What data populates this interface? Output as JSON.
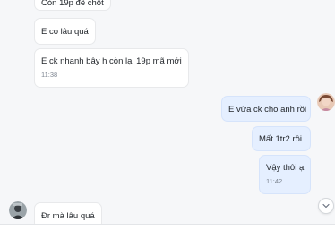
{
  "messages": [
    {
      "text": "Còn 19p để chốt",
      "direction": "incoming"
    },
    {
      "text": "E co lâu quá",
      "direction": "incoming"
    },
    {
      "text": "E ck nhanh bây h còn lại 19p mã mới",
      "time": "11:38",
      "direction": "incoming"
    },
    {
      "text": "E vừa ck cho anh rồi",
      "direction": "outgoing"
    },
    {
      "text": "Mất 1tr2 rồi",
      "direction": "outgoing"
    },
    {
      "text": "Vậy thôi ạ",
      "time": "11:42",
      "direction": "outgoing"
    },
    {
      "text": "Đr mà lâu quá",
      "direction": "incoming"
    }
  ],
  "icons": {
    "scroll_down": "chevron-down-icon",
    "my_avatar": "avatar-icon",
    "contact_avatar": "avatar-icon"
  },
  "colors": {
    "incoming_bubble": "#ffffff",
    "outgoing_bubble": "#e5efff",
    "background": "#f6f7f9"
  }
}
